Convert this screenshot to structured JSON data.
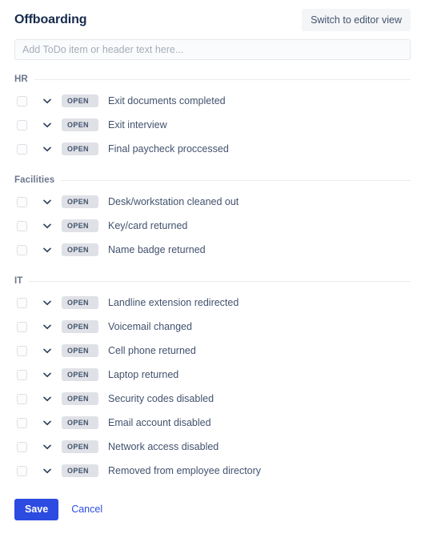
{
  "header": {
    "title": "Offboarding",
    "switch_view_label": "Switch to editor view"
  },
  "add_item": {
    "placeholder": "Add ToDo item or header text here...",
    "value": ""
  },
  "status_badge_label": "OPEN",
  "sections": [
    {
      "title": "HR",
      "items": [
        {
          "label": "Exit documents completed",
          "status": "OPEN",
          "checked": false
        },
        {
          "label": "Exit interview",
          "status": "OPEN",
          "checked": false
        },
        {
          "label": "Final paycheck proccessed",
          "status": "OPEN",
          "checked": false
        }
      ]
    },
    {
      "title": "Facilities",
      "items": [
        {
          "label": "Desk/workstation cleaned out",
          "status": "OPEN",
          "checked": false
        },
        {
          "label": "Key/card returned",
          "status": "OPEN",
          "checked": false
        },
        {
          "label": "Name badge returned",
          "status": "OPEN",
          "checked": false
        }
      ]
    },
    {
      "title": "IT",
      "items": [
        {
          "label": "Landline extension redirected",
          "status": "OPEN",
          "checked": false
        },
        {
          "label": "Voicemail changed",
          "status": "OPEN",
          "checked": false
        },
        {
          "label": "Cell phone returned",
          "status": "OPEN",
          "checked": false
        },
        {
          "label": "Laptop returned",
          "status": "OPEN",
          "checked": false
        },
        {
          "label": "Security codes disabled",
          "status": "OPEN",
          "checked": false
        },
        {
          "label": "Email account disabled",
          "status": "OPEN",
          "checked": false
        },
        {
          "label": "Network access disabled",
          "status": "OPEN",
          "checked": false
        },
        {
          "label": "Removed from employee directory",
          "status": "OPEN",
          "checked": false
        }
      ]
    }
  ],
  "footer": {
    "save_label": "Save",
    "cancel_label": "Cancel"
  },
  "icons": {
    "row_expand": "chevron-down-icon"
  },
  "colors": {
    "primary_action": "#2C4BE0",
    "title_text": "#172B4D",
    "body_text": "#42526E",
    "section_title": "#6B778C",
    "badge_background": "#DFE1E6",
    "divider": "#EBECF0",
    "input_background": "#FAFBFC",
    "secondary_button_background": "#F4F5F7"
  }
}
